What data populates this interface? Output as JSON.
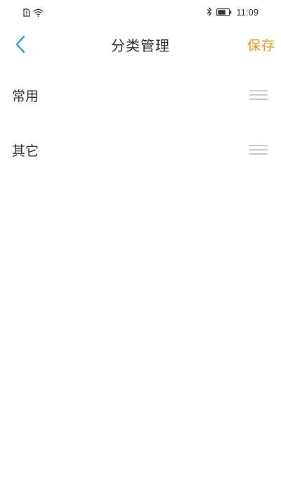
{
  "status_bar": {
    "time": "11:09",
    "icons": [
      "sim-alert-icon",
      "wifi-icon",
      "bluetooth-icon",
      "battery-icon"
    ]
  },
  "header": {
    "back_icon": "chevron-left-icon",
    "title": "分类管理",
    "save_label": "保存"
  },
  "categories": [
    {
      "label": "常用",
      "handle_icon": "drag-handle-icon"
    },
    {
      "label": "其它",
      "handle_icon": "drag-handle-icon"
    }
  ],
  "colors": {
    "accent": "#e39a28",
    "back_icon": "#1ba0c7",
    "text": "#333333",
    "handle": "#cccccc",
    "background": "#ffffff"
  }
}
